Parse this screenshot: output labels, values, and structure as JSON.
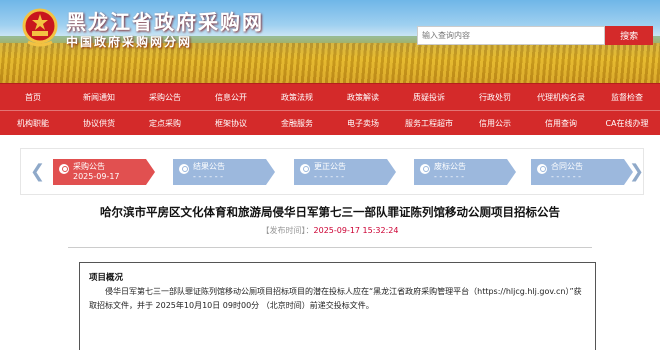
{
  "header": {
    "site_title": "黑龙江省政府采购网",
    "site_subtitle": "中国政府采购网分网",
    "emblem_icon": "national-emblem-icon",
    "search": {
      "placeholder": "输入查询内容",
      "button_label": "搜索"
    }
  },
  "nav": {
    "row1": [
      "首页",
      "新闻通知",
      "采购公告",
      "信息公开",
      "政策法规",
      "政策解读",
      "质疑投诉",
      "行政处罚",
      "代理机构名录",
      "监督检查"
    ],
    "row2": [
      "机构职能",
      "协议供货",
      "定点采购",
      "框架协议",
      "金融服务",
      "电子卖场",
      "服务工程超市",
      "信用公示",
      "信用查询",
      "CA在线办理"
    ]
  },
  "phases": [
    {
      "label": "采购公告",
      "date": "2025-09-17",
      "active": true
    },
    {
      "label": "结果公告",
      "date": "- - - - - -",
      "active": false
    },
    {
      "label": "更正公告",
      "date": "- - - - - -",
      "active": false
    },
    {
      "label": "废标公告",
      "date": "- - - - - -",
      "active": false
    },
    {
      "label": "合同公告",
      "date": "- - - - - -",
      "active": false
    }
  ],
  "article": {
    "title": "哈尔滨市平房区文化体育和旅游局侵华日军第七三一部队罪证陈列馆移动公厕项目招标公告",
    "publish_label": "【发布时间】：",
    "publish_time": "2025-09-17 15:32:24",
    "section_heading": "项目概况",
    "section_body": "侵华日军第七三一部队罪证陈列馆移动公厕项目招标项目的潜在投标人应在“黑龙江省政府采购管理平台（https://hljcg.hlj.gov.cn）”获取招标文件，并于 2025年10月10日 09时00分 （北京时间）前递交投标文件。"
  },
  "colors": {
    "nav_red": "#d42a2a",
    "active_phase": "#e15050",
    "inactive_phase": "#9cb8dd"
  }
}
